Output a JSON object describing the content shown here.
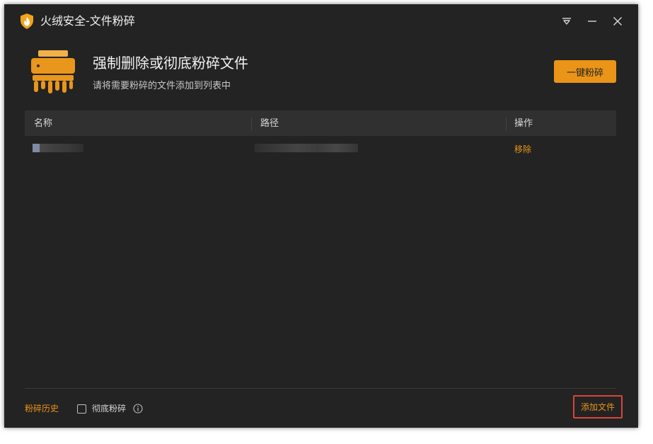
{
  "window": {
    "title": "火绒安全-文件粉碎"
  },
  "header": {
    "headline": "强制删除或彻底粉碎文件",
    "subline": "请将需要粉碎的文件添加到列表中",
    "shred_button": "一键粉碎"
  },
  "table": {
    "columns": [
      "名称",
      "路径",
      "操作"
    ],
    "rows": [
      {
        "name": "",
        "path": "",
        "action": "移除"
      }
    ]
  },
  "footer": {
    "history_link": "粉碎历史",
    "thorough_label": "彻底粉碎",
    "thorough_checked": false,
    "add_file_button": "添加文件"
  },
  "colors": {
    "accent": "#ea9517",
    "background": "#232323",
    "table_header": "#303030",
    "highlight_border": "#d9453a"
  },
  "icons": {
    "app_logo": "huorong-shield-logo-icon",
    "shredder": "file-shredder-icon",
    "menu": "dropdown-menu-icon",
    "minimize": "minimize-icon",
    "close": "close-icon",
    "info": "info-icon"
  }
}
